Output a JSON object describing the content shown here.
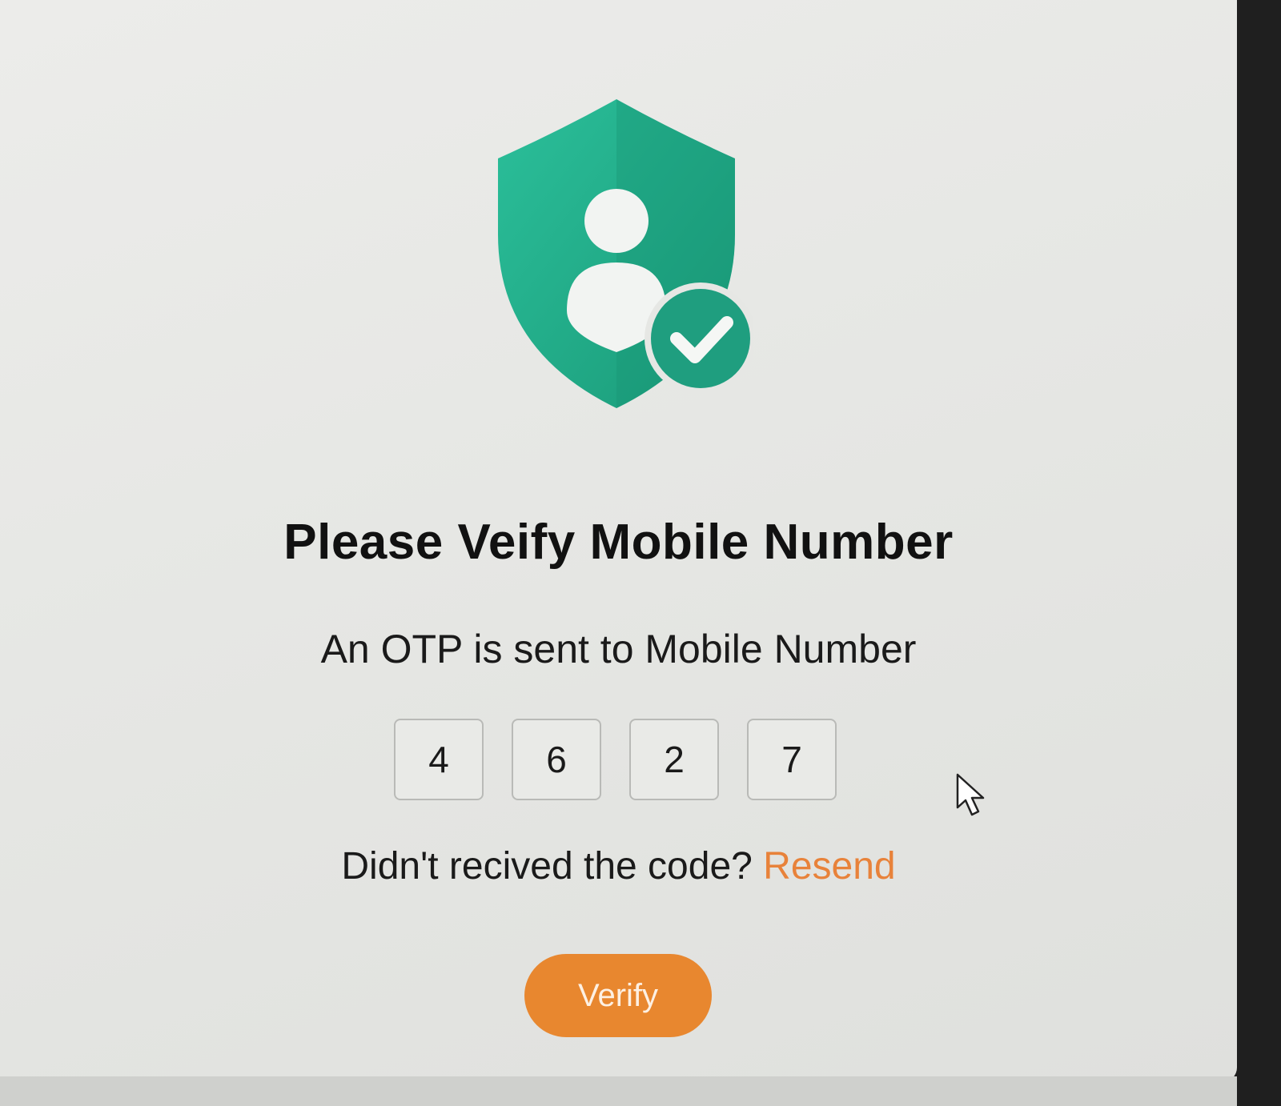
{
  "header": {
    "title": "Please Veify Mobile Number",
    "subtitle": "An OTP is sent to Mobile Number"
  },
  "icon": {
    "name": "shield-user-check-icon",
    "color": "#20a886",
    "check_color": "#1f9e7f"
  },
  "otp": {
    "digits": [
      "4",
      "6",
      "2",
      "7"
    ]
  },
  "resend": {
    "prompt": "Didn't recived the code?",
    "link_label": "Resend",
    "link_color": "#e8823a"
  },
  "actions": {
    "verify_label": "Verify",
    "verify_color": "#e8872f"
  }
}
